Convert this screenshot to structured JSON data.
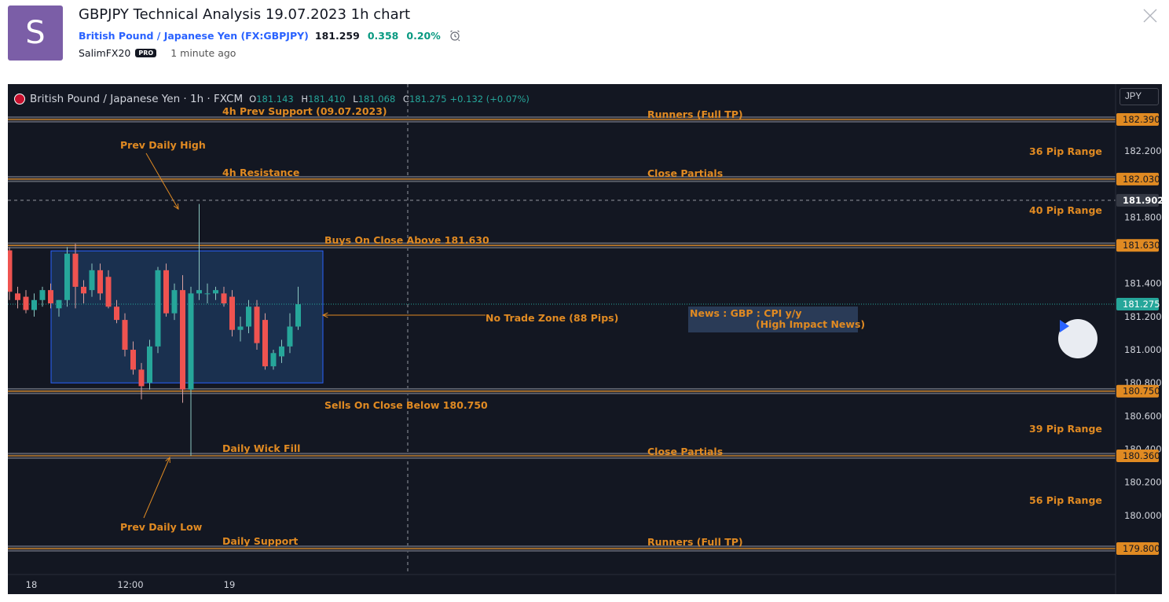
{
  "header": {
    "avatar_letter": "S",
    "title": "GBPJPY Technical Analysis 19.07.2023 1h chart",
    "symbol_name": "British Pound / Japanese Yen",
    "symbol_ticker": "FX:GBPJPY",
    "price": "181.259",
    "change": "0.358",
    "change_pct": "0.20%",
    "author": "SalimFX20",
    "badge": "PRO",
    "posted": "1 minute ago"
  },
  "chart": {
    "legend": {
      "name": "British Pound / Japanese Yen · 1h · FXCM",
      "o_label": "O",
      "o": "181.143",
      "h_label": "H",
      "h": "181.410",
      "l_label": "L",
      "l": "181.068",
      "c_label": "C",
      "c": "181.275",
      "change": "+0.132 (+0.07%)"
    },
    "currency": "JPY",
    "colors": {
      "background": "#131722",
      "up": "#26a69a",
      "down": "#ef5350",
      "level": "#e08a22",
      "zone_fill": "#1e3a5f",
      "zone_border": "#2962ff"
    },
    "x_axis": {
      "ticks": [
        {
          "label": "18",
          "bar": 2
        },
        {
          "label": "12:00",
          "bar": 14
        },
        {
          "label": "19",
          "bar": 26
        }
      ]
    },
    "y_axis": {
      "ticks": [
        {
          "value": 182.2,
          "label": "182.200"
        },
        {
          "value": 181.8,
          "label": "181.800"
        },
        {
          "value": 181.4,
          "label": "181.400"
        },
        {
          "value": 181.2,
          "label": "181.200"
        },
        {
          "value": 181.0,
          "label": "181.000"
        },
        {
          "value": 180.8,
          "label": "180.800"
        },
        {
          "value": 180.6,
          "label": "180.600"
        },
        {
          "value": 180.4,
          "label": "180.400"
        },
        {
          "value": 180.2,
          "label": "180.200"
        },
        {
          "value": 180.0,
          "label": "180.000"
        }
      ],
      "badges": [
        {
          "value": 182.39,
          "label": "182.390",
          "kind": "level"
        },
        {
          "value": 182.03,
          "label": "182.030",
          "kind": "level"
        },
        {
          "value": 181.902,
          "label": "181.902",
          "kind": "cross"
        },
        {
          "value": 181.63,
          "label": "181.630",
          "kind": "level"
        },
        {
          "value": 181.275,
          "label": "181.275",
          "kind": "last"
        },
        {
          "value": 180.75,
          "label": "180.750",
          "kind": "level"
        },
        {
          "value": 180.36,
          "label": "180.360",
          "kind": "level"
        },
        {
          "value": 179.8,
          "label": "179.800",
          "kind": "level"
        }
      ]
    },
    "levels": [
      182.39,
      182.03,
      181.63,
      180.75,
      180.36,
      179.8
    ],
    "crosshair_price": 181.902,
    "last_price": 181.275,
    "no_trade_zone": {
      "top": 181.63,
      "bottom": 180.8,
      "bar_start": 2.5,
      "bar_end": 19.3
    },
    "annotations": {
      "prev_support": "4h Prev Support (09.07.2023)",
      "runners_top": "Runners (Full TP)",
      "prev_daily_high": "Prev Daily High",
      "range_36": "36 Pip Range",
      "resistance_4h": "4h Resistance",
      "close_partials_top": "Close Partials",
      "range_40": "40 Pip Range",
      "buys": "Buys On Close Above 181.630",
      "no_trade": "No Trade Zone (88 Pips)",
      "news_1": "News : GBP : CPI y/y",
      "news_2": "(High Impact News)",
      "sells": "Sells On Close Below 180.750",
      "range_39": "39 Pip Range",
      "daily_wick_fill": "Daily Wick Fill",
      "close_partials_bottom": "Close Partials",
      "range_56": "56 Pip Range",
      "prev_daily_low": "Prev Daily Low",
      "daily_support": "Daily Support",
      "runners_bottom": "Runners (Full TP)"
    }
  },
  "chart_data": {
    "type": "candlestick",
    "x": [
      0,
      1,
      2,
      3,
      4,
      5,
      6,
      7,
      8,
      9,
      10,
      11,
      12,
      13,
      14,
      15,
      16,
      17,
      18,
      19,
      20,
      21,
      22,
      23,
      24,
      25,
      26,
      27,
      28,
      29,
      30,
      31,
      32,
      33,
      34,
      35
    ],
    "x_tick_labels": {
      "2": "18",
      "14": "12:00",
      "26": "19"
    },
    "ylim": [
      179.7,
      182.5
    ],
    "candles": [
      {
        "o": 181.6,
        "h": 181.62,
        "l": 181.3,
        "c": 181.35
      },
      {
        "o": 181.34,
        "h": 181.38,
        "l": 181.25,
        "c": 181.3
      },
      {
        "o": 181.32,
        "h": 181.36,
        "l": 181.22,
        "c": 181.24
      },
      {
        "o": 181.24,
        "h": 181.34,
        "l": 181.2,
        "c": 181.3
      },
      {
        "o": 181.3,
        "h": 181.38,
        "l": 181.26,
        "c": 181.36
      },
      {
        "o": 181.36,
        "h": 181.4,
        "l": 181.25,
        "c": 181.28
      },
      {
        "o": 181.25,
        "h": 181.3,
        "l": 181.2,
        "c": 181.3
      },
      {
        "o": 181.3,
        "h": 181.62,
        "l": 181.26,
        "c": 181.58
      },
      {
        "o": 181.58,
        "h": 181.64,
        "l": 181.25,
        "c": 181.38
      },
      {
        "o": 181.38,
        "h": 181.42,
        "l": 181.28,
        "c": 181.34
      },
      {
        "o": 181.36,
        "h": 181.52,
        "l": 181.32,
        "c": 181.48
      },
      {
        "o": 181.48,
        "h": 181.52,
        "l": 181.3,
        "c": 181.34
      },
      {
        "o": 181.44,
        "h": 181.48,
        "l": 181.25,
        "c": 181.26
      },
      {
        "o": 181.26,
        "h": 181.3,
        "l": 181.16,
        "c": 181.18
      },
      {
        "o": 181.18,
        "h": 181.22,
        "l": 180.96,
        "c": 181.0
      },
      {
        "o": 181.0,
        "h": 181.05,
        "l": 180.85,
        "c": 180.88
      },
      {
        "o": 180.88,
        "h": 180.92,
        "l": 180.7,
        "c": 180.78
      },
      {
        "o": 180.8,
        "h": 181.06,
        "l": 180.76,
        "c": 181.02
      },
      {
        "o": 181.02,
        "h": 181.5,
        "l": 180.98,
        "c": 181.48
      },
      {
        "o": 181.48,
        "h": 181.52,
        "l": 181.2,
        "c": 181.22
      },
      {
        "o": 181.22,
        "h": 181.4,
        "l": 181.18,
        "c": 181.36
      },
      {
        "o": 181.36,
        "h": 181.45,
        "l": 180.68,
        "c": 180.76
      },
      {
        "o": 180.76,
        "h": 181.38,
        "l": 180.36,
        "c": 181.34
      },
      {
        "o": 181.34,
        "h": 181.88,
        "l": 181.3,
        "c": 181.36
      },
      {
        "o": 181.34,
        "h": 181.4,
        "l": 181.28,
        "c": 181.34
      },
      {
        "o": 181.34,
        "h": 181.38,
        "l": 181.3,
        "c": 181.36
      },
      {
        "o": 181.34,
        "h": 181.38,
        "l": 181.26,
        "c": 181.28
      },
      {
        "o": 181.32,
        "h": 181.36,
        "l": 181.08,
        "c": 181.12
      },
      {
        "o": 181.12,
        "h": 181.2,
        "l": 181.05,
        "c": 181.14
      },
      {
        "o": 181.14,
        "h": 181.3,
        "l": 181.1,
        "c": 181.26
      },
      {
        "o": 181.26,
        "h": 181.3,
        "l": 181.0,
        "c": 181.04
      },
      {
        "o": 181.18,
        "h": 181.22,
        "l": 180.88,
        "c": 180.9
      },
      {
        "o": 180.9,
        "h": 181.0,
        "l": 180.88,
        "c": 180.98
      },
      {
        "o": 180.96,
        "h": 181.06,
        "l": 180.92,
        "c": 181.02
      },
      {
        "o": 181.02,
        "h": 181.22,
        "l": 180.98,
        "c": 181.14
      },
      {
        "o": 181.14,
        "h": 181.38,
        "l": 181.12,
        "c": 181.275
      }
    ]
  }
}
